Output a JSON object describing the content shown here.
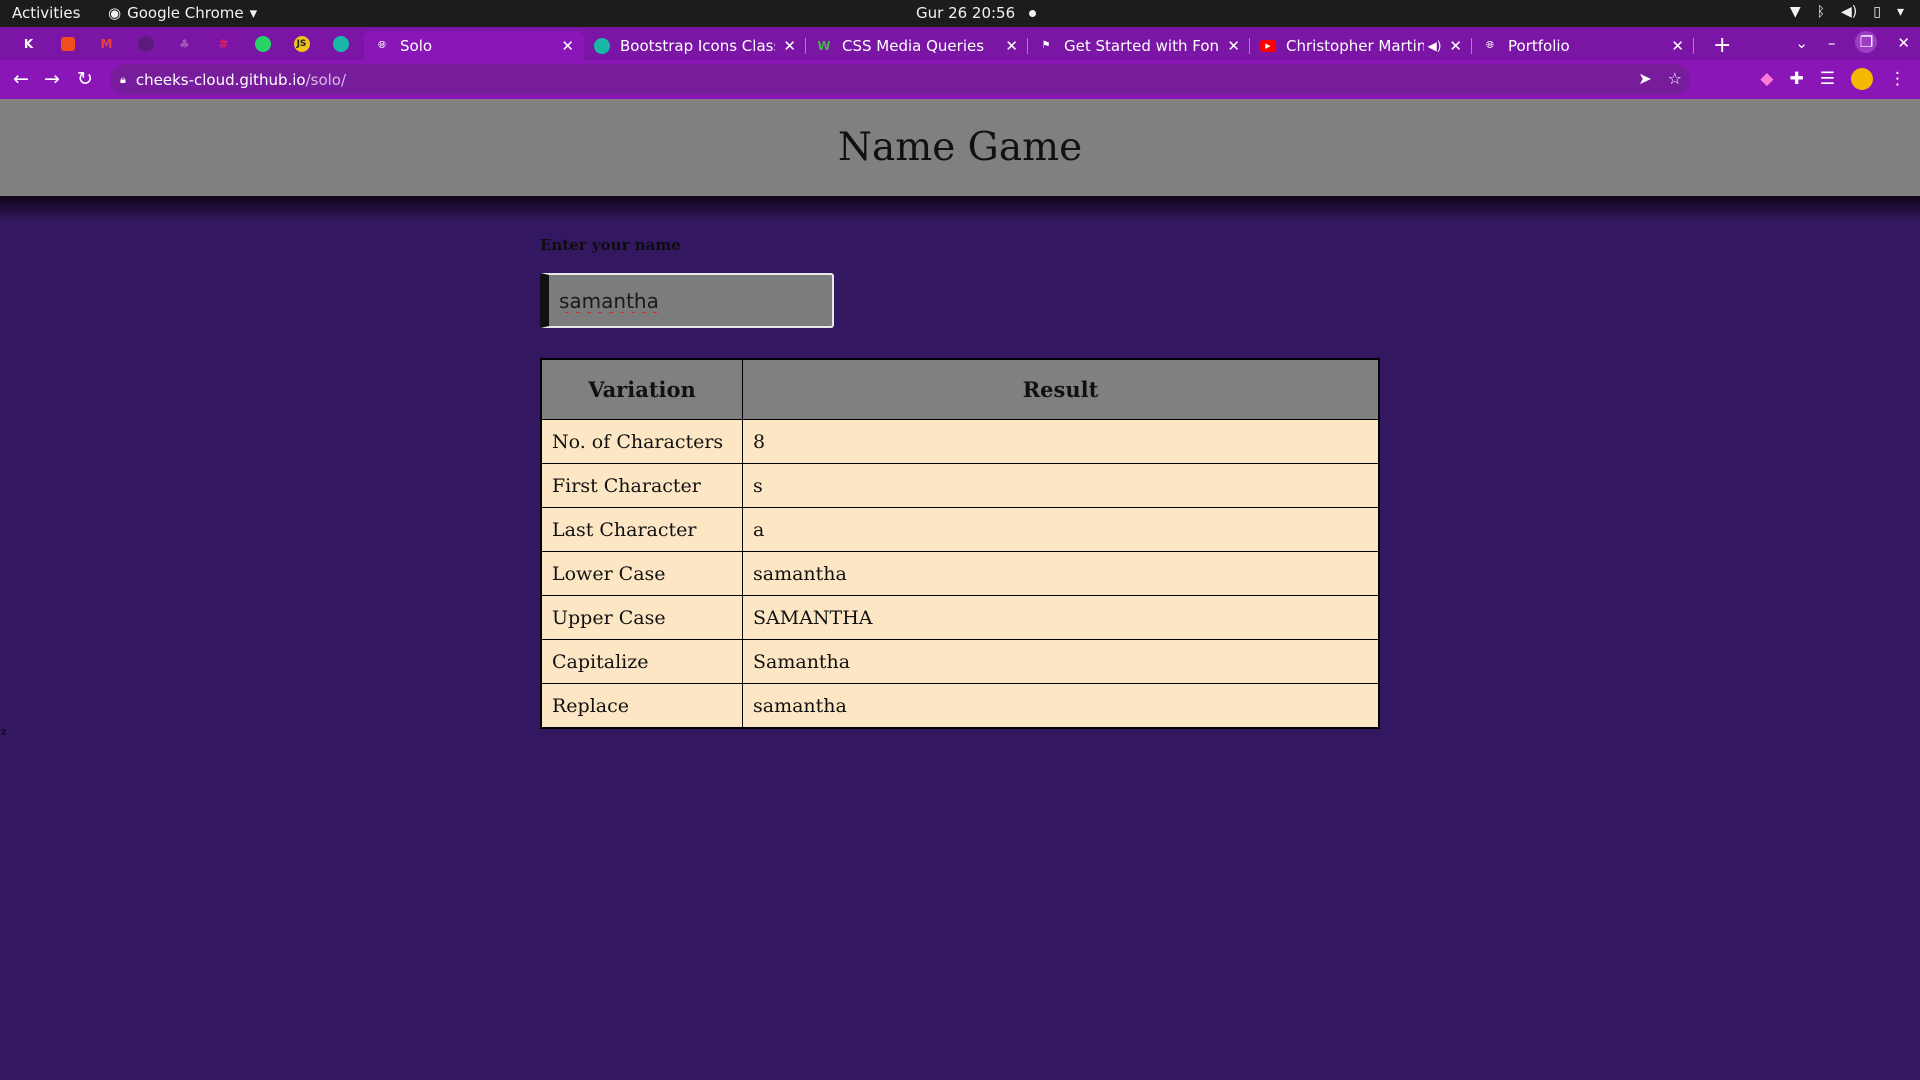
{
  "system_bar": {
    "activities": "Activities",
    "app_name": "Google Chrome",
    "clock": "Gur 26  20:56"
  },
  "tabs": [
    {
      "title": "Solo",
      "active": true,
      "favicon": "globe-icon"
    },
    {
      "title": "Bootstrap Icons Class L",
      "active": false,
      "favicon": "bootstrap-icon"
    },
    {
      "title": "CSS Media Queries",
      "active": false,
      "favicon": "w-icon"
    },
    {
      "title": "Get Started with Font A",
      "active": false,
      "favicon": "flag-icon"
    },
    {
      "title": "Christopher Martin",
      "active": false,
      "favicon": "youtube-icon"
    },
    {
      "title": "Portfolio",
      "active": false,
      "favicon": "globe-icon"
    }
  ],
  "address_bar": {
    "host": "cheeks-cloud.github.io",
    "path": "/solo/"
  },
  "page": {
    "title": "Name Game",
    "input_label": "Enter your name",
    "input_value": "samantha",
    "table": {
      "headers": [
        "Variation",
        "Result"
      ],
      "rows": [
        [
          "No. of Characters",
          "8"
        ],
        [
          "First Character",
          "s"
        ],
        [
          "Last Character",
          "a"
        ],
        [
          "Lower Case",
          "samantha"
        ],
        [
          "Upper Case",
          "SAMANTHA"
        ],
        [
          "Capitalize",
          "Samantha"
        ],
        [
          "Replace",
          "samantha"
        ]
      ]
    },
    "stray_text": "z"
  },
  "colors": {
    "page_background": "#331861",
    "header_background": "#808080",
    "table_cell_background": "#fde6c4",
    "chrome_theme": "#8a16b8"
  }
}
